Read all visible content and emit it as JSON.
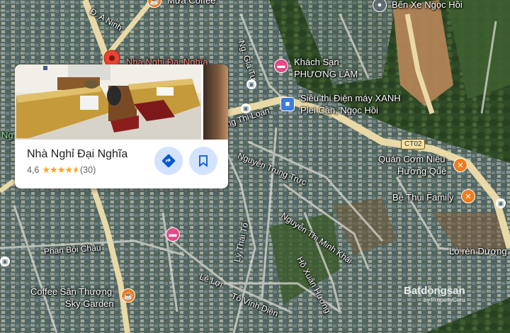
{
  "map": {
    "pois": {
      "ben_xe": "Bến Xe Ngọc Hồi",
      "khach_san_line1": "Khách Sạn",
      "khach_san_line2": "PHƯƠNG LÂM",
      "sieu_thi_line1": "Siêu thị Điện máy XANH",
      "sieu_thi_line2": "Plei Cần, Ngọc Hồi",
      "quan_com_line1": "Quán Cơm Niêu",
      "quan_com_line2": "Hương Quê",
      "be_thui": "Bê Thui Family",
      "lo_ren": "Lò rèn Dương",
      "coffee_line1": "Coffee Sân Thượng",
      "coffee_line2": "Sky Garden",
      "pinned_label": "Nhà Nghỉ Đại Nghĩa",
      "top_cut": "Mưa Coffee"
    },
    "streets": {
      "a_ninh": "Đ. A Ninh",
      "gia_tu": "Ng. Gia Tự",
      "hung_thi_loan": "ng Thị Loan",
      "nguyen_trung_truc": "Nguyễn Trung Trực",
      "nguyen_thi_minh_khai": "Nguyễn Thị Minh Khai",
      "ho_xuan_huong": "Hồ Xuân Hương",
      "phan_boi_chau": "Phan Bội Châu",
      "le_loi": "Lê Lợi",
      "ly_thai_to": "Lý Thái Tổ",
      "to_vinh_dien": "Tô Vĩnh Diện"
    },
    "road_shield": "CT02",
    "watermark": "Batdongsan",
    "watermark_sub": "by PropertyGuru",
    "left_edge_fragment": "Ng"
  },
  "card": {
    "name": "Nhà Nghỉ Đại Nghĩa",
    "rating": "4,6",
    "stars": 4.6,
    "review_count": "(30)"
  },
  "icons": {
    "directions": "directions-icon",
    "save": "bookmark-icon",
    "hotel": "hotel-icon",
    "restaurant": "restaurant-icon",
    "cafe": "cafe-icon",
    "store": "shopping-bag-icon",
    "bus": "bus-icon"
  },
  "colors": {
    "road": "#e9d9a6",
    "card_button_bg": "#d3e3fd",
    "card_button_icon": "#0b57d0",
    "pin_red": "#ea4335",
    "hotel_pink": "#e34a86",
    "food_orange": "#ef7c1f",
    "store_blue": "#3b7ddd"
  }
}
